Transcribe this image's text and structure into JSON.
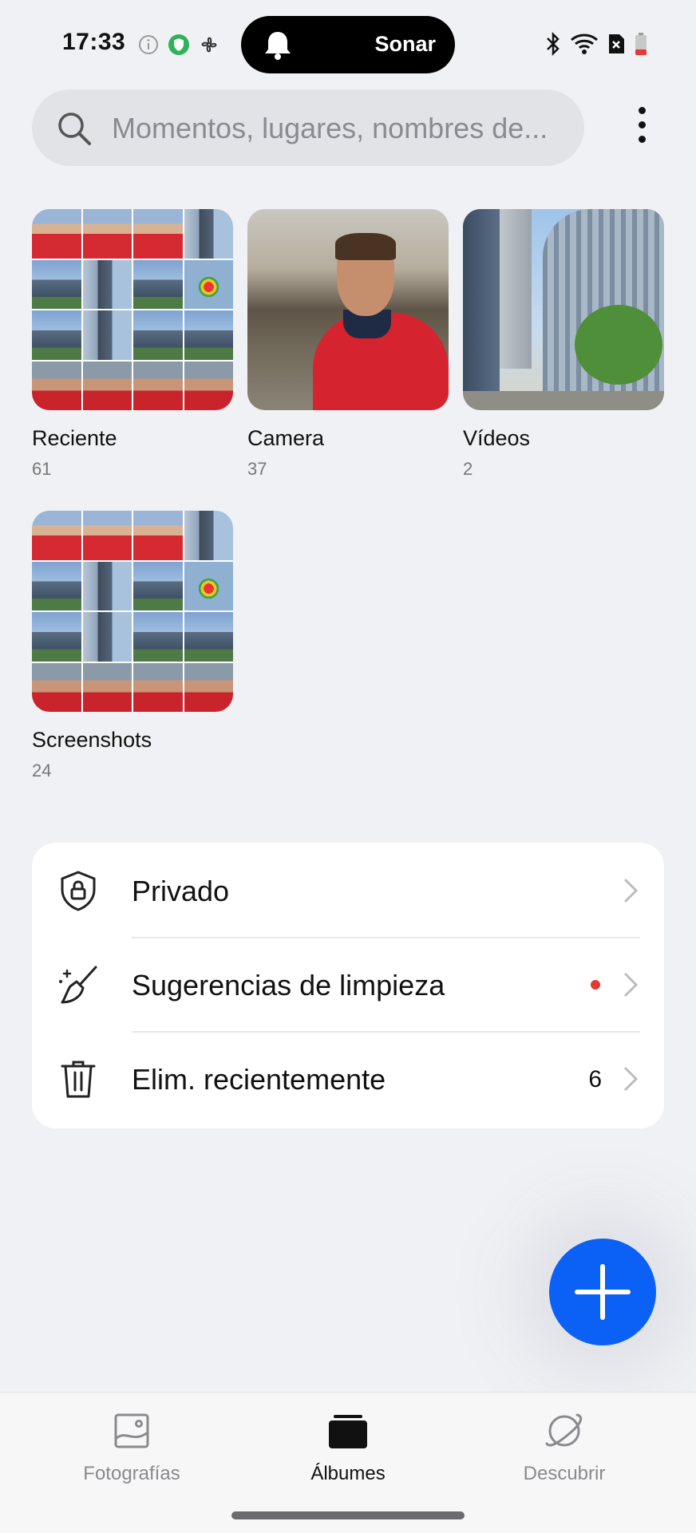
{
  "status_bar": {
    "time": "17:33",
    "alert_label": "Sonar"
  },
  "search": {
    "placeholder": "Momentos, lugares, nombres de..."
  },
  "albums": [
    {
      "name": "Reciente",
      "count": "61"
    },
    {
      "name": "Camera",
      "count": "37"
    },
    {
      "name": "Vídeos",
      "count": "2"
    },
    {
      "name": "Screenshots",
      "count": "24"
    }
  ],
  "list": {
    "privado": {
      "label": "Privado"
    },
    "sugerencias": {
      "label": "Sugerencias de limpieza"
    },
    "eliminados": {
      "label": "Elim. recientemente",
      "count": "6"
    }
  },
  "bottom_nav": {
    "fotografias": "Fotografías",
    "albumes": "Álbumes",
    "descubrir": "Descubrir"
  },
  "colors": {
    "accent": "#0b61f5",
    "background": "#f0f1f4",
    "badge_dot": "#e53935"
  }
}
